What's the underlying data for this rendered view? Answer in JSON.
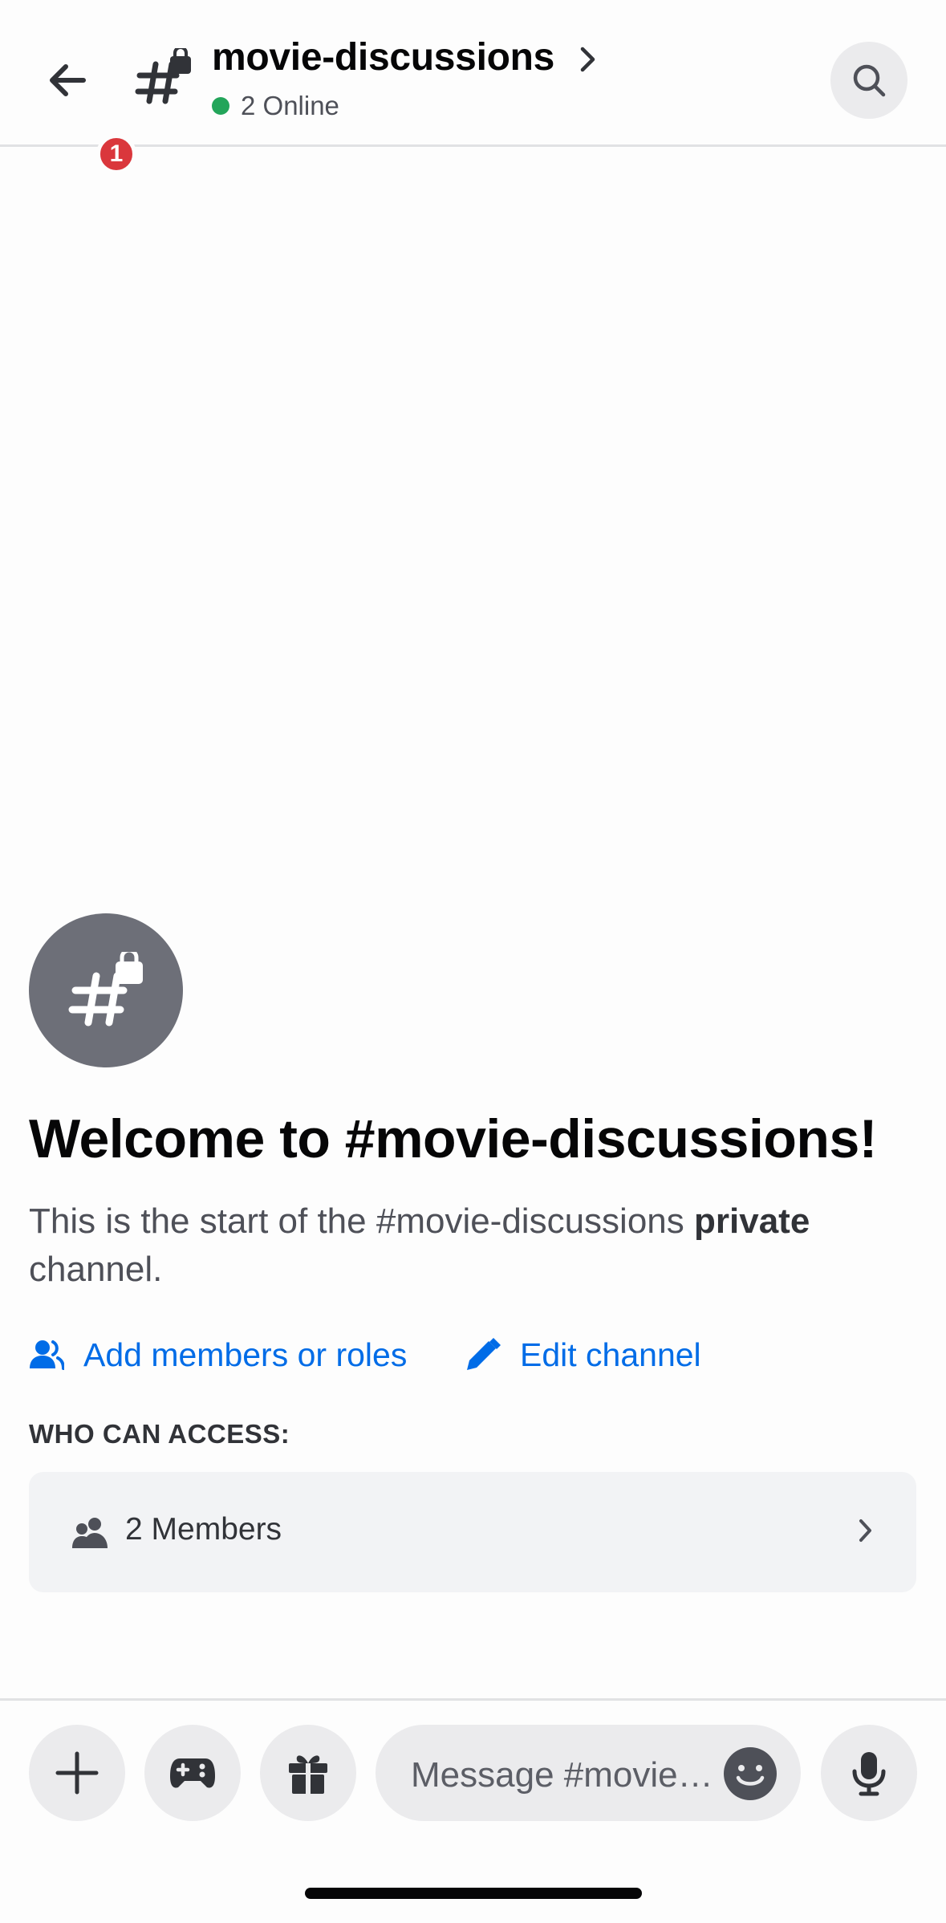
{
  "header": {
    "back_badge_count": "1",
    "channel_name": "movie-discussions",
    "online_status": "2 Online"
  },
  "welcome": {
    "title": "Welcome to #movie-discussions!",
    "description_start": "This is the start of the #movie-discussions ",
    "description_bold": "private",
    "description_end": " channel."
  },
  "actions": {
    "add_members_label": "Add members or roles",
    "edit_channel_label": "Edit channel"
  },
  "access": {
    "section_label": "WHO CAN ACCESS:",
    "members_label": "2 Members"
  },
  "composer": {
    "placeholder": "Message #movie…"
  },
  "colors": {
    "accent_link": "#006ce7",
    "online_green": "#23a55a",
    "badge_red": "#da373c"
  },
  "icons": {
    "back": "arrow-left-icon",
    "channel": "hashtag-lock-icon",
    "search": "search-icon",
    "add_members": "person-add-icon",
    "edit": "pencil-icon",
    "members": "people-icon",
    "plus": "plus-icon",
    "game": "gamepad-icon",
    "gift": "gift-icon",
    "emoji": "emoji-icon",
    "mic": "microphone-icon"
  }
}
